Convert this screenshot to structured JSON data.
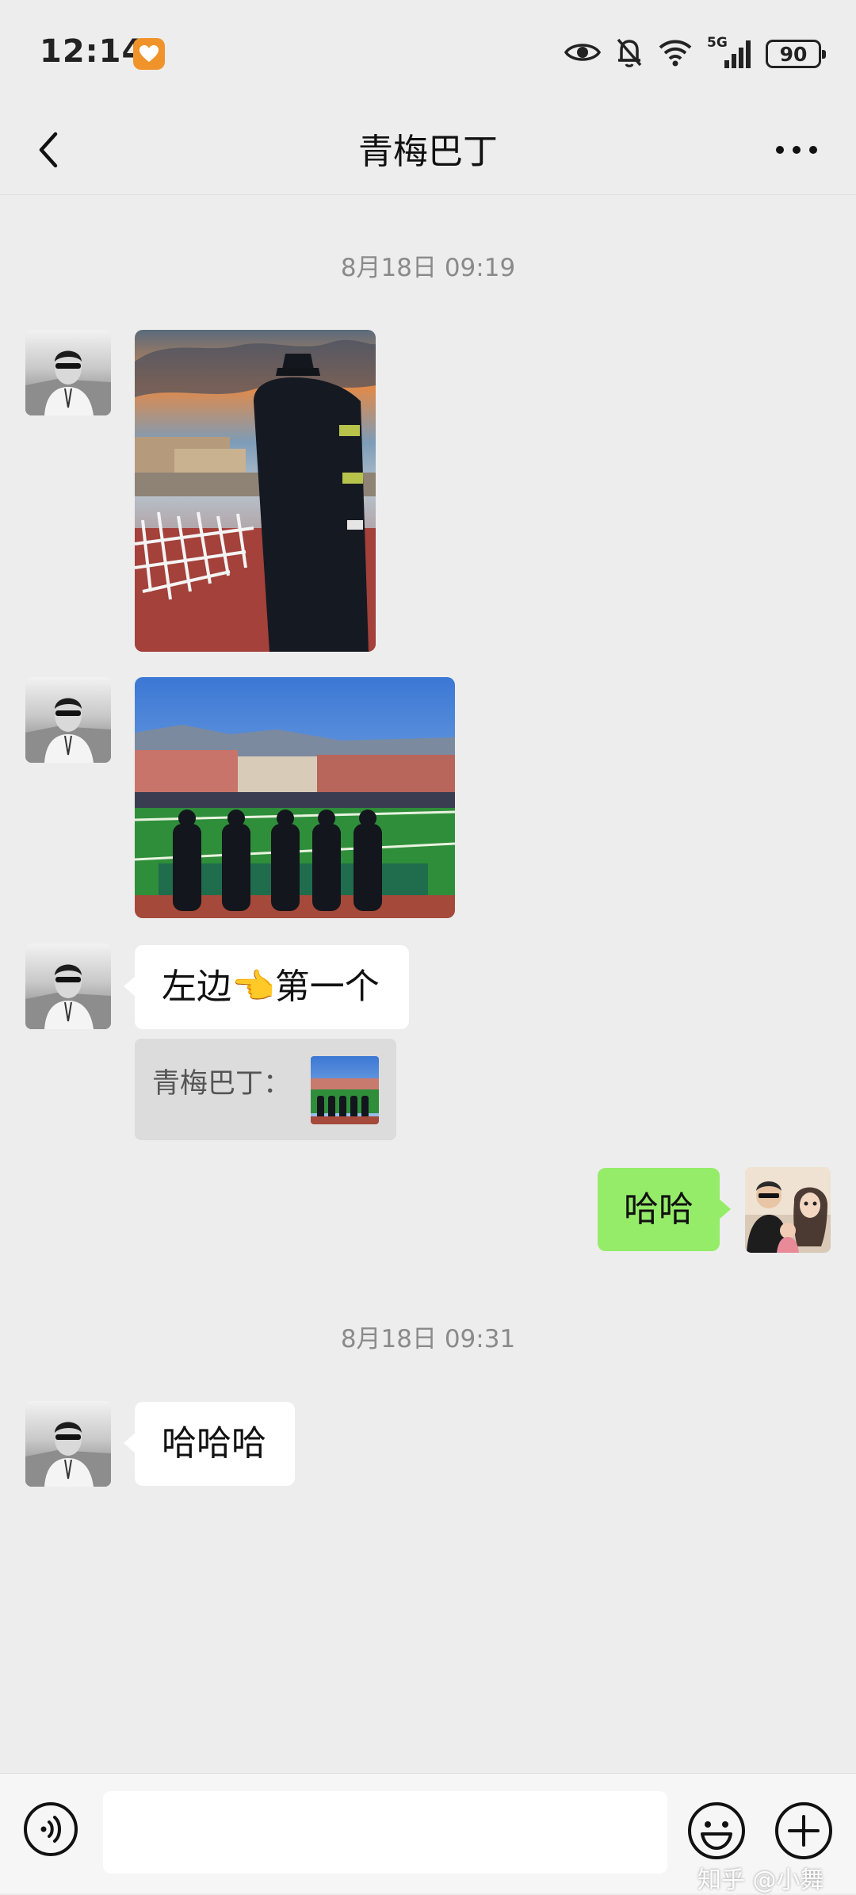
{
  "status_bar": {
    "time": "12:14",
    "network": "5G",
    "battery": "90"
  },
  "header": {
    "title": "青梅巴丁"
  },
  "chat": {
    "timestamp_1": "8月18日 09:19",
    "message_3_text": "左边👈第一个",
    "quote_sender": "青梅巴丁：",
    "message_4_text": "哈哈",
    "timestamp_2": "8月18日 09:31",
    "message_5_text": "哈哈哈"
  },
  "input": {
    "placeholder": ""
  },
  "watermark": "知乎 @小舞",
  "colors": {
    "background": "#ededed",
    "outgoing_bubble": "#95ec69",
    "incoming_bubble": "#ffffff"
  }
}
